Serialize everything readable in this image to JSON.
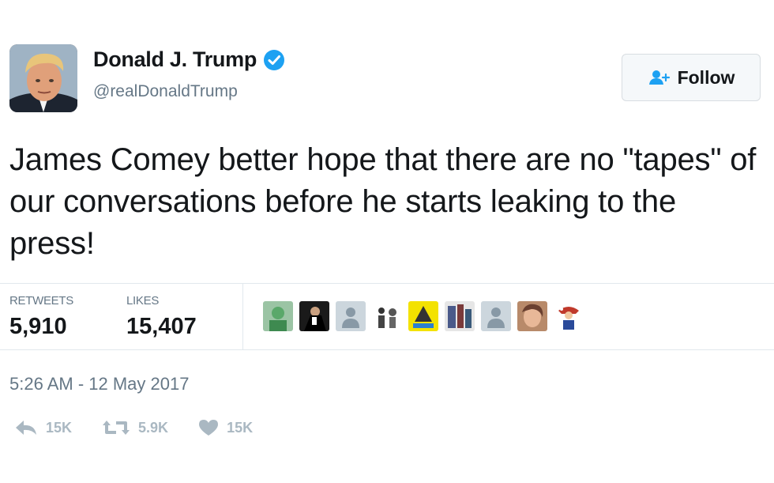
{
  "tweet": {
    "author_name": "Donald J. Trump",
    "author_handle": "@realDonaldTrump",
    "follow_label": "Follow",
    "text": "James Comey better hope that there are no \"tapes\" of our conversations before he starts leaking to the press!",
    "retweets_label": "RETWEETS",
    "retweets_count": "5,910",
    "likes_label": "LIKES",
    "likes_count": "15,407",
    "timestamp": "5:26 AM - 12 May 2017",
    "actions": {
      "reply_count": "15K",
      "retweet_count": "5.9K",
      "like_count": "15K"
    }
  },
  "icons": {
    "verified": "verified-badge-icon",
    "follow": "add-user-icon",
    "reply": "reply-icon",
    "retweet": "retweet-icon",
    "like": "heart-icon"
  },
  "colors": {
    "verified_blue": "#1da1f2",
    "secondary_text": "#657786",
    "action_gray": "#aab8c2",
    "divider": "#e1e8ed"
  }
}
